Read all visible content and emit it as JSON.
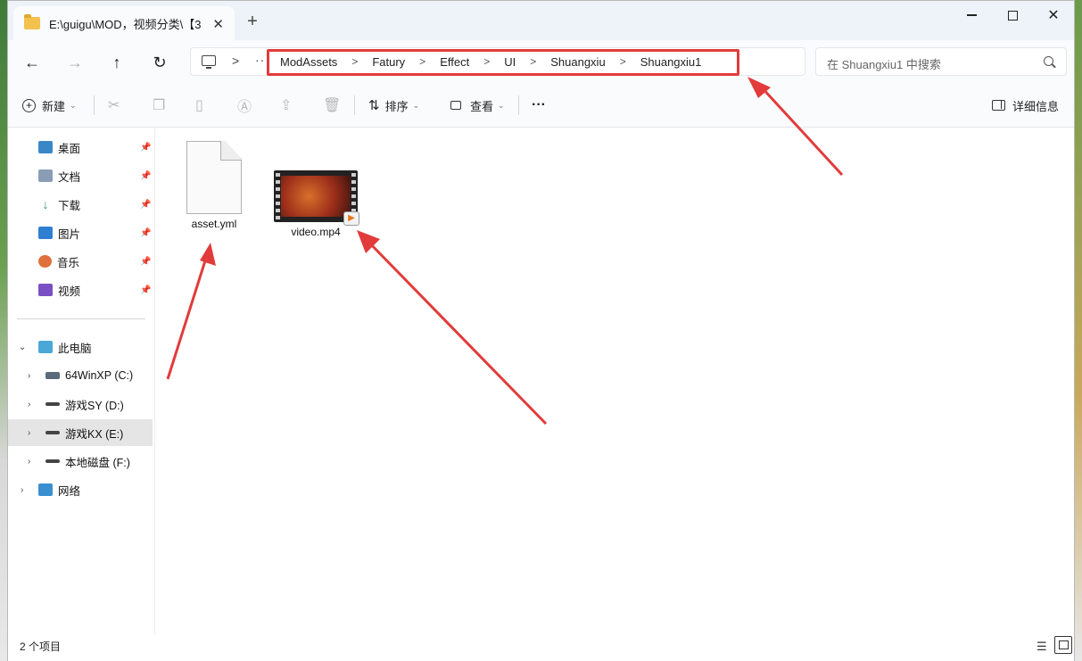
{
  "window": {
    "tab_title": "E:\\guigu\\MOD，视频分类\\【3",
    "tab_close": "✕",
    "new_tab": "+"
  },
  "nav": {
    "back": "←",
    "forward": "→",
    "up": "↑",
    "refresh": "↻",
    "more": "···",
    "breadcrumbs": [
      "ModAssets",
      "Fatury",
      "Effect",
      "UI",
      "Shuangxiu",
      "Shuangxiu1"
    ],
    "sep": ">",
    "search_placeholder": "在 Shuangxiu1 中搜索"
  },
  "toolbar": {
    "new_label": "新建",
    "sort_label": "排序",
    "view_label": "查看",
    "more": "···",
    "details_label": "详细信息"
  },
  "sidebar": {
    "quick_access": [
      {
        "label": "桌面",
        "icon": "desktop-icon",
        "color": "#3a87c8"
      },
      {
        "label": "文档",
        "icon": "documents-icon",
        "color": "#8a9db5"
      },
      {
        "label": "下载",
        "icon": "downloads-icon",
        "color": "#2a9d6a"
      },
      {
        "label": "图片",
        "icon": "pictures-icon",
        "color": "#2f7fd1"
      },
      {
        "label": "音乐",
        "icon": "music-icon",
        "color": "#e0703c"
      },
      {
        "label": "视频",
        "icon": "videos-icon",
        "color": "#7a4fc4"
      }
    ],
    "this_pc": "此电脑",
    "drives": [
      {
        "label": "64WinXP  (C:)"
      },
      {
        "label": "游戏SY (D:)"
      },
      {
        "label": "游戏KX (E:)",
        "selected": true
      },
      {
        "label": "本地磁盘 (F:)"
      }
    ],
    "network": "网络"
  },
  "files": [
    {
      "name": "asset.yml",
      "icon": "document-file-icon"
    },
    {
      "name": "video.mp4",
      "icon": "video-file-icon"
    }
  ],
  "status": {
    "item_count": "2 个项目"
  },
  "colors": {
    "accent": "#e23b3b",
    "selection": "#e5e5e5"
  }
}
